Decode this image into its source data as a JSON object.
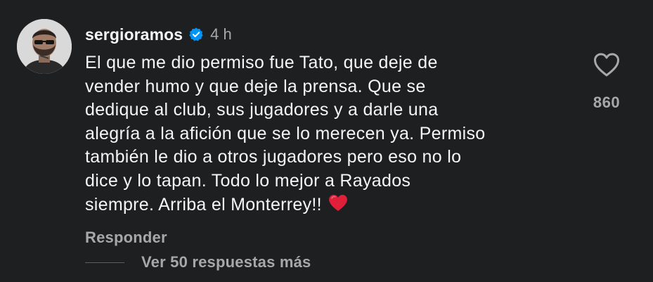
{
  "comment": {
    "username": "sergioramos",
    "verified": true,
    "time_ago": "4 h",
    "text": "El que me dio permiso fue Tato, que deje de\nvender humo y que deje la prensa.  Que se\ndedique al club, sus jugadores y a darle una\nalegría a la afición que se lo merecen ya.  Permiso\ntambién le dio a otros jugadores pero eso no lo\ndice y lo tapan.  Todo lo mejor a Rayados\nsiempre. Arriba el Monterrey!!",
    "emoji": "red-heart-emoji",
    "reply_label": "Responder",
    "more_replies_label": "Ver 50 respuestas más"
  },
  "like": {
    "icon": "heart-outline-icon",
    "count": "860"
  },
  "colors": {
    "background": "#1e1f21",
    "primary_text": "#f5f5f5",
    "secondary_text": "#a8a8a8",
    "verified_blue": "#0095f6",
    "emoji_red": "#e0203a"
  }
}
